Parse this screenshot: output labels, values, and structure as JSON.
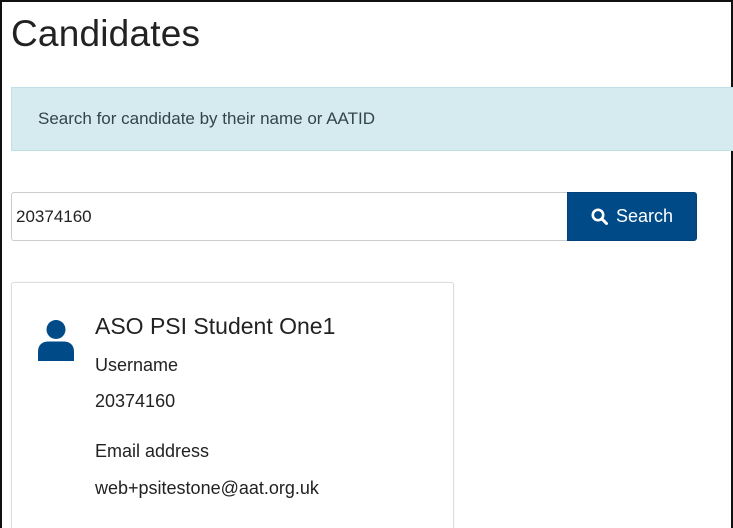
{
  "page": {
    "title": "Candidates"
  },
  "banner": {
    "text": "Search for candidate by their name or AATID"
  },
  "search": {
    "value": "20374160",
    "button_label": "Search",
    "button_icon": "search-icon",
    "button_color": "#004b87"
  },
  "candidate": {
    "name": "ASO PSI Student One1",
    "avatar_icon": "user-icon",
    "avatar_color": "#004b87",
    "username_label": "Username",
    "username_value": "20374160",
    "email_label": "Email address",
    "email_value": "web+psitestone@aat.org.uk"
  }
}
